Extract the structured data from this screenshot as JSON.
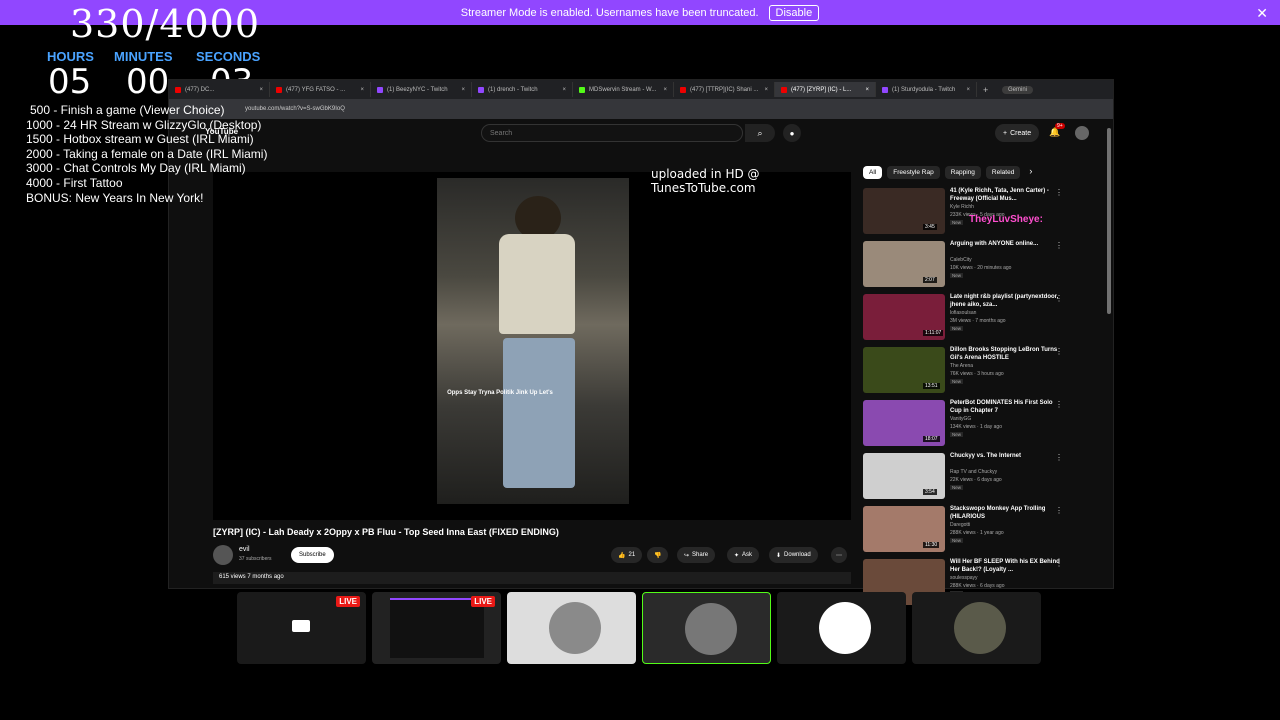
{
  "banner": {
    "message": "Streamer Mode is enabled. Usernames have been truncated.",
    "disable_label": "Disable",
    "close": "✕"
  },
  "overlay": {
    "goal_count": "330/4000",
    "labels": {
      "hours": "HOURS",
      "minutes": "MINUTES",
      "seconds": "SECONDS"
    },
    "values": {
      "hours": "05",
      "minutes": "00",
      "seconds": "03"
    },
    "goals": [
      "500 -  Finish a game (Viewer Choice)",
      "1000 - 24 HR Stream w GlizzyGlo (Desktop)",
      "1500 - Hotbox stream w Guest (IRL Miami)",
      "2000 - Taking a female on a Date (IRL Miami)",
      "3000 - Chat Controls My Day (IRL Miami)",
      "4000 - First Tattoo",
      "BONUS: New Years In New York!"
    ]
  },
  "browser": {
    "tabs": [
      {
        "label": "(477) DC..."
      },
      {
        "label": "(477) YFG FATSO - ..."
      },
      {
        "label": "(1) BeezyNYC - Twitch"
      },
      {
        "label": "(1) drench - Twitch"
      },
      {
        "label": "MDSwervin Stream - W..."
      },
      {
        "label": "(477) [TTRP](IC) Shani ..."
      },
      {
        "label": "(477) [ZYRP] (IC) - L..."
      },
      {
        "label": "(1) Sturdyodula - Twitch"
      }
    ],
    "new_tab": "+",
    "gemini": "Gemini",
    "url": "youtube.com/watch?v=S-swGbK9IoQ"
  },
  "youtube": {
    "logo": "YouTube",
    "search_placeholder": "Search",
    "create_label": "Create",
    "notif_badge": "9+",
    "uploaded_text": "uploaded in HD @ TunesToTube.com",
    "video_caption": "Opps Stay Tryna Politik Jink Up Let's",
    "video_title": "[ZYRP] (IC) - Lah Deady x 2Oppy x PB Fluu - Top Seed Inna East (FIXED ENDING)",
    "channel": {
      "name": "evil",
      "subs": "37 subscribers"
    },
    "subscribe_label": "Subscribe",
    "actions": {
      "likes": "21",
      "share": "Share",
      "ask": "Ask",
      "download": "Download"
    },
    "views_line": "615 views  7 months ago",
    "chips": [
      "All",
      "Freestyle Rap",
      "Rapping",
      "Related"
    ],
    "chat_name": "TheyLuvSheye:",
    "recommendations": [
      {
        "title": "41 (Kyle Richh, Tata, Jenn Carter) - Freeway (Official Mus...",
        "channel": "Kyle Richh",
        "meta": "233K views · 5 days ago",
        "duration": "3:45",
        "color": "#3a2a24"
      },
      {
        "title": "Arguing with ANYONE online...",
        "channel": "CalebCity",
        "meta": "10K views · 20 minutes ago",
        "duration": "2:07",
        "color": "#9a8a7a"
      },
      {
        "title": "Late night r&b playlist (partynextdoor, jhene aiko, sza...",
        "channel": "lofiasoulsan",
        "meta": "3M views · 7 months ago",
        "duration": "1:11:07",
        "color": "#7a1e3a"
      },
      {
        "title": "Dillon Brooks Stopping LeBron Turns Gil's Arena HOSTILE",
        "channel": "The Arena",
        "meta": "76K views · 3 hours ago",
        "duration": "13:51",
        "color": "#3a4a1a"
      },
      {
        "title": "PeterBot DOMINATES His First Solo Cup in Chapter 7",
        "channel": "VanityGG",
        "meta": "134K views · 1 day ago",
        "duration": "18:07",
        "color": "#8a4ab0"
      },
      {
        "title": "Chuckyy vs. The Internet",
        "channel": "Rap TV and Chuckyy",
        "meta": "22K views · 6 days ago",
        "duration": "3:54",
        "color": "#cfcfcf"
      },
      {
        "title": "Stackswopo Monkey App Trolling (HILARIOUS",
        "channel": "Daregotti",
        "meta": "288K views · 1 year ago",
        "duration": "11:30",
        "color": "#a47a6a"
      },
      {
        "title": "Will Her BF SLEEP With his EX Behind Her Back!? (Loyalty ...",
        "channel": "soulesspayy",
        "meta": "288K views · 6 days ago",
        "duration": "",
        "color": "#6a4a3a"
      }
    ],
    "new_label": "New"
  },
  "sources": [
    {
      "live": "LIVE"
    },
    {
      "live": "LIVE"
    },
    {
      "live": ""
    },
    {
      "live": ""
    },
    {
      "live": ""
    },
    {
      "live": ""
    }
  ]
}
